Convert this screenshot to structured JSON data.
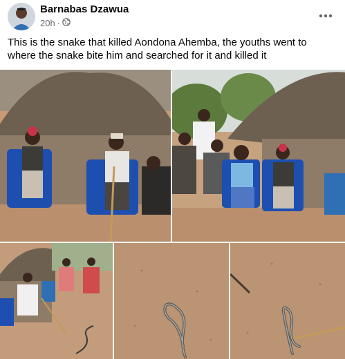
{
  "post": {
    "author": "Barnabas Dzawua",
    "time": "20h",
    "separator": "·",
    "privacy_icon": "globe-icon",
    "more_icon": "more-options-icon",
    "caption": "This is the snake that killed Aondona Ahemba, the youths went to where the snake bite him and searched for it and killed it"
  },
  "photos": [
    {
      "subject": "group-seated-outside-hut"
    },
    {
      "subject": "crowd-gathered-by-hut"
    },
    {
      "subject": "villagers-and-snake"
    },
    {
      "subject": "dead-snake-on-ground"
    },
    {
      "subject": "dead-snake-with-stick"
    }
  ],
  "colors": {
    "text_primary": "#050505",
    "text_secondary": "#65676b",
    "ground": "#b98f6d",
    "thatch": "#6e6050"
  }
}
